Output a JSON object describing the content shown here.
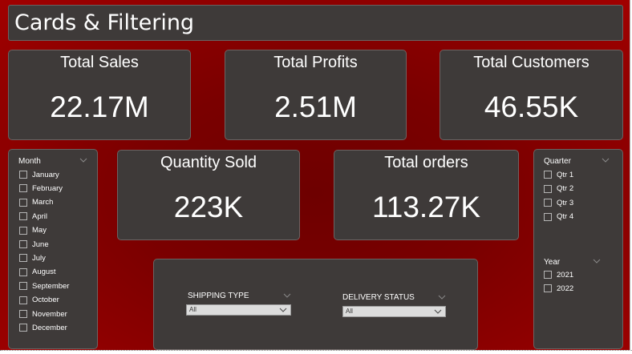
{
  "page": {
    "title": "Cards & Filtering"
  },
  "cards": {
    "total_sales": {
      "label": "Total Sales",
      "value": "22.17M"
    },
    "total_profits": {
      "label": "Total Profits",
      "value": "2.51M"
    },
    "total_customers": {
      "label": "Total Customers",
      "value": "46.55K"
    },
    "quantity_sold": {
      "label": "Quantity Sold",
      "value": "223K"
    },
    "total_orders": {
      "label": "Total orders",
      "value": "113.27K"
    }
  },
  "month_slicer": {
    "header": "Month",
    "items": [
      "January",
      "February",
      "March",
      "April",
      "May",
      "June",
      "July",
      "August",
      "September",
      "October",
      "November",
      "December"
    ]
  },
  "quarter_slicer": {
    "header": "Quarter",
    "items": [
      "Qtr 1",
      "Qtr 2",
      "Qtr 3",
      "Qtr 4"
    ]
  },
  "year_slicer": {
    "header": "Year",
    "items": [
      "2021",
      "2022"
    ]
  },
  "shipping_type": {
    "label": "SHIPPING TYPE",
    "selected": "All"
  },
  "delivery_status": {
    "label": "DELIVERY STATUS",
    "selected": "All"
  },
  "icons": {
    "chevron": "chevron-down-icon",
    "checkbox": "checkbox-icon"
  },
  "colors": {
    "background": "#7a0000",
    "panel": "#3e3a39",
    "text": "#ffffff"
  }
}
